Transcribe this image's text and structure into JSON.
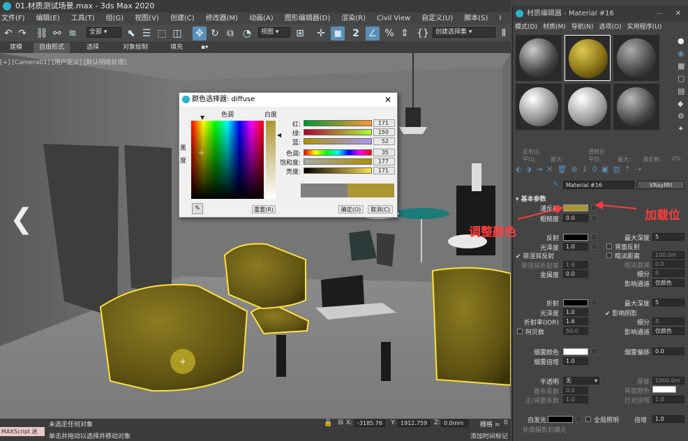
{
  "app": {
    "title": "01.材质测试场景.max - 3ds Max 2020"
  },
  "menubar": [
    "文件(F)",
    "编辑(E)",
    "工具(T)",
    "组(G)",
    "视图(V)",
    "创建(C)",
    "修改器(M)",
    "动画(A)",
    "图形编辑器(D)",
    "渲染(R)",
    "Civil View",
    "自定义(U)",
    "脚本(S)",
    "I"
  ],
  "toolbar": {
    "filter": "全部",
    "view": "视图",
    "selset": "创建选择集",
    "snap": "2"
  },
  "ribbon": [
    "建模",
    "自由形式",
    "选择",
    "对象绘制",
    "填充"
  ],
  "viewport": {
    "label": "[+] [Camera01] [用户定义] [默认明暗处理]"
  },
  "status": {
    "script": "MAXScript 迷",
    "line1": "未选定任何对象",
    "line2": "单击并拖动以选择并移动对象",
    "x_label": "X:",
    "x": "-3185.76",
    "y_label": "Y:",
    "y": "1912.759",
    "z_label": "Z:",
    "z": "0.0mm",
    "grid": "栅格 =",
    "grid_val": "0",
    "addkey": "添加时间标记"
  },
  "color_picker": {
    "title": "颜色选择器: diffuse",
    "hue_label": "色调",
    "white_label": "白度",
    "black_label": "黑",
    "deg_label": "度",
    "rows": [
      {
        "label": "红:",
        "value": "171"
      },
      {
        "label": "绿:",
        "value": "150"
      },
      {
        "label": "蓝:",
        "value": "52"
      },
      {
        "label": "色调:",
        "value": "35"
      },
      {
        "label": "饱和度:",
        "value": "177"
      },
      {
        "label": "亮度:",
        "value": "171"
      }
    ],
    "reset": "重置(R)",
    "ok": "确定(O)",
    "cancel": "取消(C)",
    "old_color": "#7f7f7f",
    "new_color": "#ab9634"
  },
  "mat_editor": {
    "title": "材质编辑器 - Material #16",
    "menu": [
      "模式(D)",
      "材质(M)",
      "导航(N)",
      "选项(O)",
      "实用程序(U)"
    ],
    "refl_row": {
      "a": "反射比",
      "b": "透射比",
      "c": "平均:",
      "d": "最大:",
      "e": "平均:",
      "f": "最大:",
      "g": "漫反射:",
      "h": "0%"
    },
    "material_name": "Material #16",
    "material_type": "VRayMtl",
    "section": "基本参数",
    "diffuse": "漫反射",
    "roughness": "粗糙度",
    "rough_val": "0.0",
    "reflect": "反射",
    "gloss": "光泽度",
    "gloss_val": "1.0",
    "fresnel": "菲涅耳反射",
    "fresnel_ior": "菲涅耳折射率",
    "fresnel_ior_val": "1.6",
    "metal": "金属度",
    "metal_val": "0.0",
    "maxdepth": "最大深度",
    "maxdepth_val": "5",
    "backrefl": "背面反射",
    "dimdist": "暗淡距离",
    "dimdist_val": "100.0m",
    "dimfall": "暗淡衰减",
    "dimfall_val": "0.0",
    "subdiv": "细分",
    "subdiv_val": "8",
    "affect_ch": "影响通道",
    "affect_val": "仅颜色",
    "refract": "折射",
    "r_gloss": "光泽度",
    "r_gloss_val": "1.0",
    "ior": "折射率(IOR)",
    "ior_val": "1.6",
    "abbe": "阿贝数",
    "abbe_val": "50.0",
    "r_maxdepth": "最大深度",
    "r_maxdepth_val": "5",
    "affect_shadow": "影响阴影",
    "r_subdiv": "细分",
    "r_subdiv_val": "8",
    "r_affect_ch": "影响通道",
    "r_affect_val": "仅颜色",
    "fog_color": "烟雾颜色",
    "fog_mult": "烟雾倍增",
    "fog_mult_val": "1.0",
    "fog_bias": "烟雾偏移",
    "fog_bias_val": "0.0",
    "translucent": "半透明",
    "trans_val": "无",
    "scatter": "散布系数",
    "scatter_val": "0.0",
    "fb": "正/背面系数",
    "fb_val": "1.0",
    "thickness": "厚度",
    "thickness_val": "1000.0m",
    "backcolor": "背面颜色",
    "light_mult": "灯光倍增",
    "light_mult_val": "1.0",
    "selfillum": "自发光",
    "gi": "全局照明",
    "mult": "倍增",
    "mult_val": "1.0",
    "bottom": "补偿摄影机曝光"
  },
  "annotations": {
    "adjust": "调整颜色",
    "load": "加载位"
  },
  "colors": {
    "diffuse": "#ab9634",
    "accent": "#5b8fb8",
    "annotation": "#ff3c3c"
  }
}
